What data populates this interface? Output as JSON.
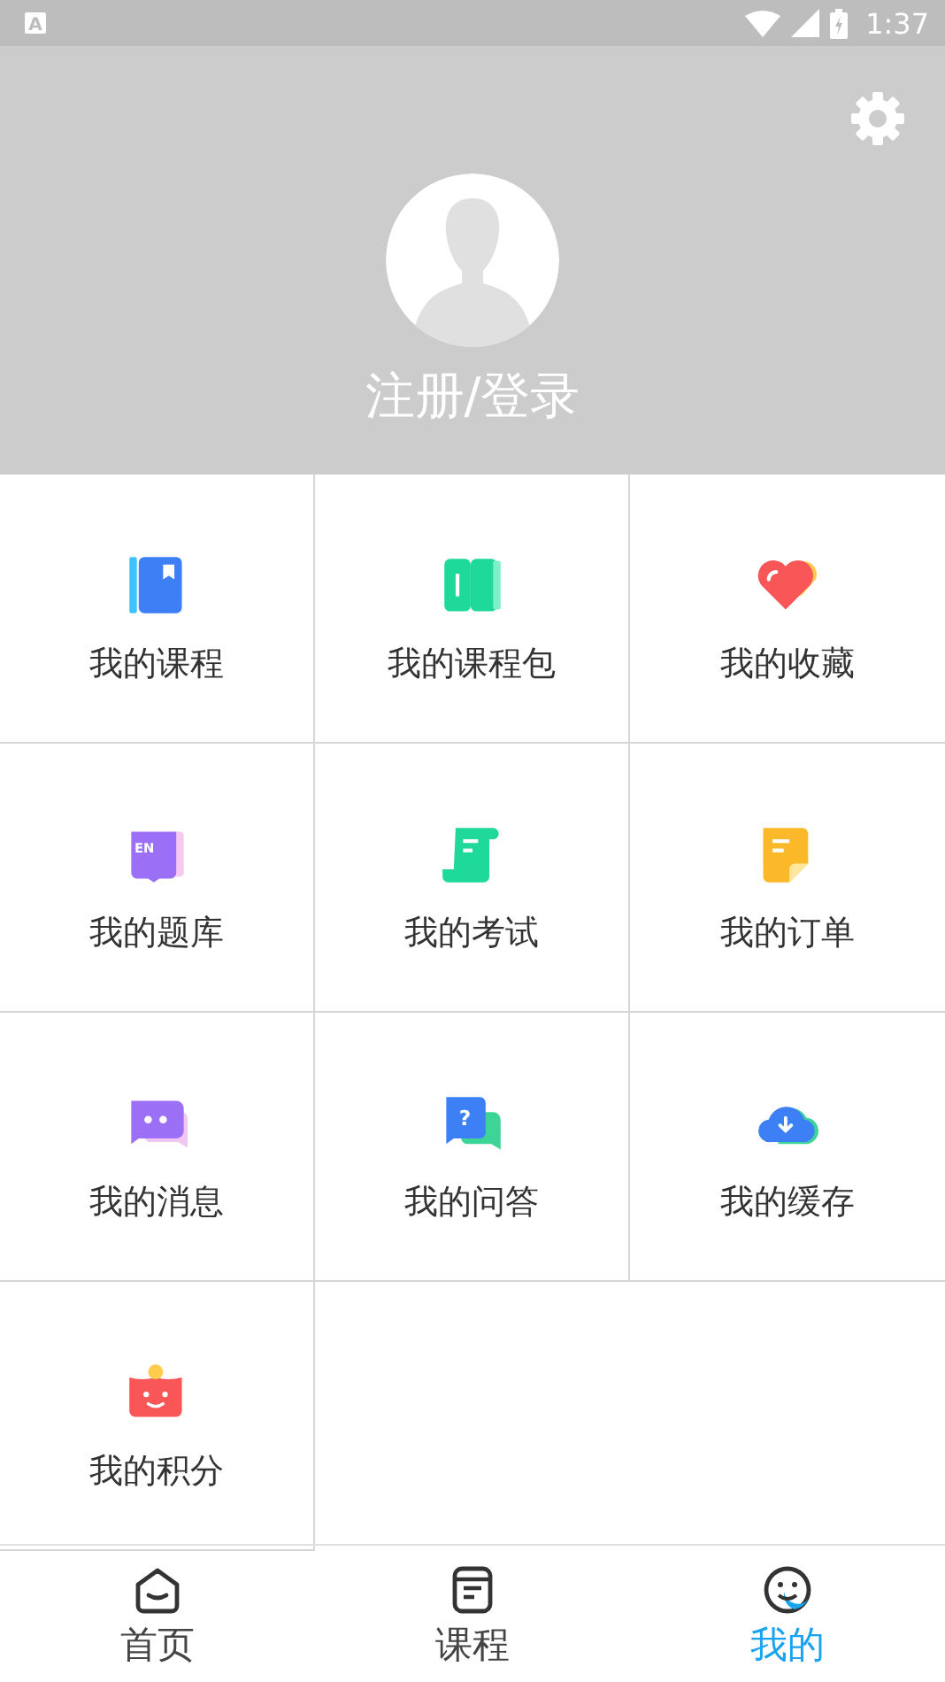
{
  "status_bar": {
    "notification": "A",
    "time": "1:37"
  },
  "profile": {
    "login": "注册/登录"
  },
  "menu": [
    {
      "label": "我的课程"
    },
    {
      "label": "我的课程包"
    },
    {
      "label": "我的收藏"
    },
    {
      "label": "我的题库",
      "badge": "EN"
    },
    {
      "label": "我的考试"
    },
    {
      "label": "我的订单"
    },
    {
      "label": "我的消息"
    },
    {
      "label": "我的问答",
      "badge": "?"
    },
    {
      "label": "我的缓存"
    },
    {
      "label": "我的积分"
    }
  ],
  "tabs": [
    {
      "label": "首页",
      "selected": false
    },
    {
      "label": "课程",
      "selected": false
    },
    {
      "label": "我的",
      "selected": true
    }
  ]
}
